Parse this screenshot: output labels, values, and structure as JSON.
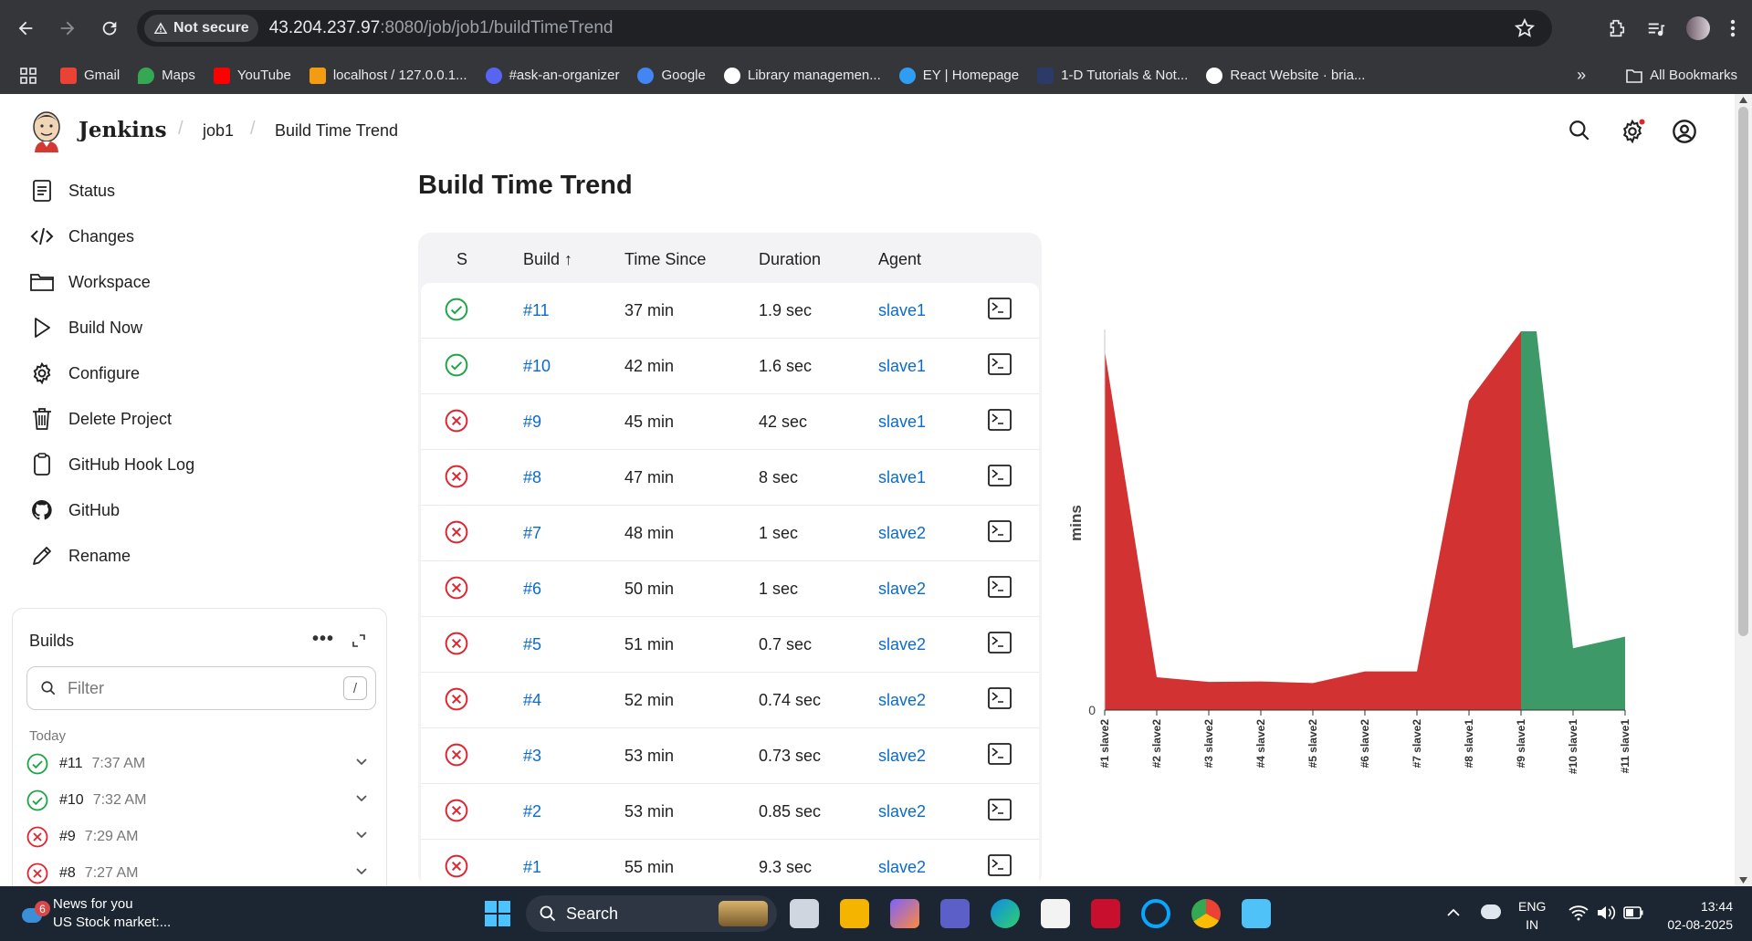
{
  "browser": {
    "security_label": "Not secure",
    "url_host": "43.204.237.97",
    "url_rest": ":8080/job/job1/buildTimeTrend",
    "bookmarks": [
      {
        "label": "Gmail",
        "color": "#ea4335"
      },
      {
        "label": "Maps",
        "color": "#34a853"
      },
      {
        "label": "YouTube",
        "color": "#ff0000"
      },
      {
        "label": "localhost / 127.0.0.1...",
        "color": "#f39c12"
      },
      {
        "label": "#ask-an-organizer",
        "color": "#5865f2"
      },
      {
        "label": "Google",
        "color": "#4285f4"
      },
      {
        "label": "Library managemen...",
        "color": "#ffffff"
      },
      {
        "label": "EY | Homepage",
        "color": "#2f9df4"
      },
      {
        "label": "1-D Tutorials & Not...",
        "color": "#2b3a67"
      },
      {
        "label": "React Website · bria...",
        "color": "#ffffff"
      }
    ],
    "all_bookmarks": "All Bookmarks"
  },
  "header": {
    "brand": "Jenkins",
    "crumbs": [
      "job1",
      "Build Time Trend"
    ]
  },
  "sidebar": {
    "items": [
      {
        "label": "Status",
        "icon": "status-icon"
      },
      {
        "label": "Changes",
        "icon": "code-icon"
      },
      {
        "label": "Workspace",
        "icon": "folder-icon"
      },
      {
        "label": "Build Now",
        "icon": "play-icon"
      },
      {
        "label": "Configure",
        "icon": "gear-icon"
      },
      {
        "label": "Delete Project",
        "icon": "trash-icon"
      },
      {
        "label": "GitHub Hook Log",
        "icon": "clipboard-icon"
      },
      {
        "label": "GitHub",
        "icon": "github-icon"
      },
      {
        "label": "Rename",
        "icon": "pencil-icon"
      }
    ]
  },
  "builds_widget": {
    "title": "Builds",
    "filter_placeholder": "Filter",
    "filter_shortcut": "/",
    "group": "Today",
    "rows": [
      {
        "num": "#11",
        "time": "7:37 AM",
        "status": "success"
      },
      {
        "num": "#10",
        "time": "7:32 AM",
        "status": "success"
      },
      {
        "num": "#9",
        "time": "7:29 AM",
        "status": "failed"
      },
      {
        "num": "#8",
        "time": "7:27 AM",
        "status": "failed"
      }
    ]
  },
  "main": {
    "title": "Build Time Trend",
    "columns": [
      "S",
      "Build ↑",
      "Time Since",
      "Duration",
      "Agent"
    ],
    "rows": [
      {
        "status": "success",
        "build": "#11",
        "since": "37 min",
        "duration": "1.9 sec",
        "agent": "slave1"
      },
      {
        "status": "success",
        "build": "#10",
        "since": "42 min",
        "duration": "1.6 sec",
        "agent": "slave1"
      },
      {
        "status": "failed",
        "build": "#9",
        "since": "45 min",
        "duration": "42 sec",
        "agent": "slave1"
      },
      {
        "status": "failed",
        "build": "#8",
        "since": "47 min",
        "duration": "8 sec",
        "agent": "slave1"
      },
      {
        "status": "failed",
        "build": "#7",
        "since": "48 min",
        "duration": "1 sec",
        "agent": "slave2"
      },
      {
        "status": "failed",
        "build": "#6",
        "since": "50 min",
        "duration": "1 sec",
        "agent": "slave2"
      },
      {
        "status": "failed",
        "build": "#5",
        "since": "51 min",
        "duration": "0.7 sec",
        "agent": "slave2"
      },
      {
        "status": "failed",
        "build": "#4",
        "since": "52 min",
        "duration": "0.74 sec",
        "agent": "slave2"
      },
      {
        "status": "failed",
        "build": "#3",
        "since": "53 min",
        "duration": "0.73 sec",
        "agent": "slave2"
      },
      {
        "status": "failed",
        "build": "#2",
        "since": "53 min",
        "duration": "0.85 sec",
        "agent": "slave2"
      },
      {
        "status": "failed",
        "build": "#1",
        "since": "55 min",
        "duration": "9.3 sec",
        "agent": "slave2"
      }
    ]
  },
  "colors": {
    "success": "#1ea446",
    "failed": "#e0242d",
    "link": "#0b6bcb",
    "area_failed": "#d33233",
    "area_success": "#3d9a68"
  },
  "chart_data": {
    "type": "area",
    "ylabel": "mins",
    "y_tick_labels": [
      "0"
    ],
    "categories": [
      "#1 slave2",
      "#2 slave2",
      "#3 slave2",
      "#4 slave2",
      "#5 slave2",
      "#6 slave2",
      "#7 slave2",
      "#8 slave1",
      "#9 slave1",
      "#10 slave1",
      "#11 slave1"
    ],
    "values_sec": [
      9.3,
      0.85,
      0.73,
      0.74,
      0.7,
      1.0,
      1.0,
      8,
      42,
      1.6,
      1.9
    ],
    "status": [
      "failed",
      "failed",
      "failed",
      "failed",
      "failed",
      "failed",
      "failed",
      "failed",
      "failed",
      "success",
      "success"
    ],
    "ylim_sec": [
      0,
      9.8
    ],
    "legend": "none"
  },
  "taskbar": {
    "news_count": "6",
    "news_title": "News for you",
    "news_sub": "US Stock market:...",
    "search": "Search",
    "lang1": "ENG",
    "lang2": "IN",
    "time": "13:44",
    "date": "02-08-2025"
  }
}
